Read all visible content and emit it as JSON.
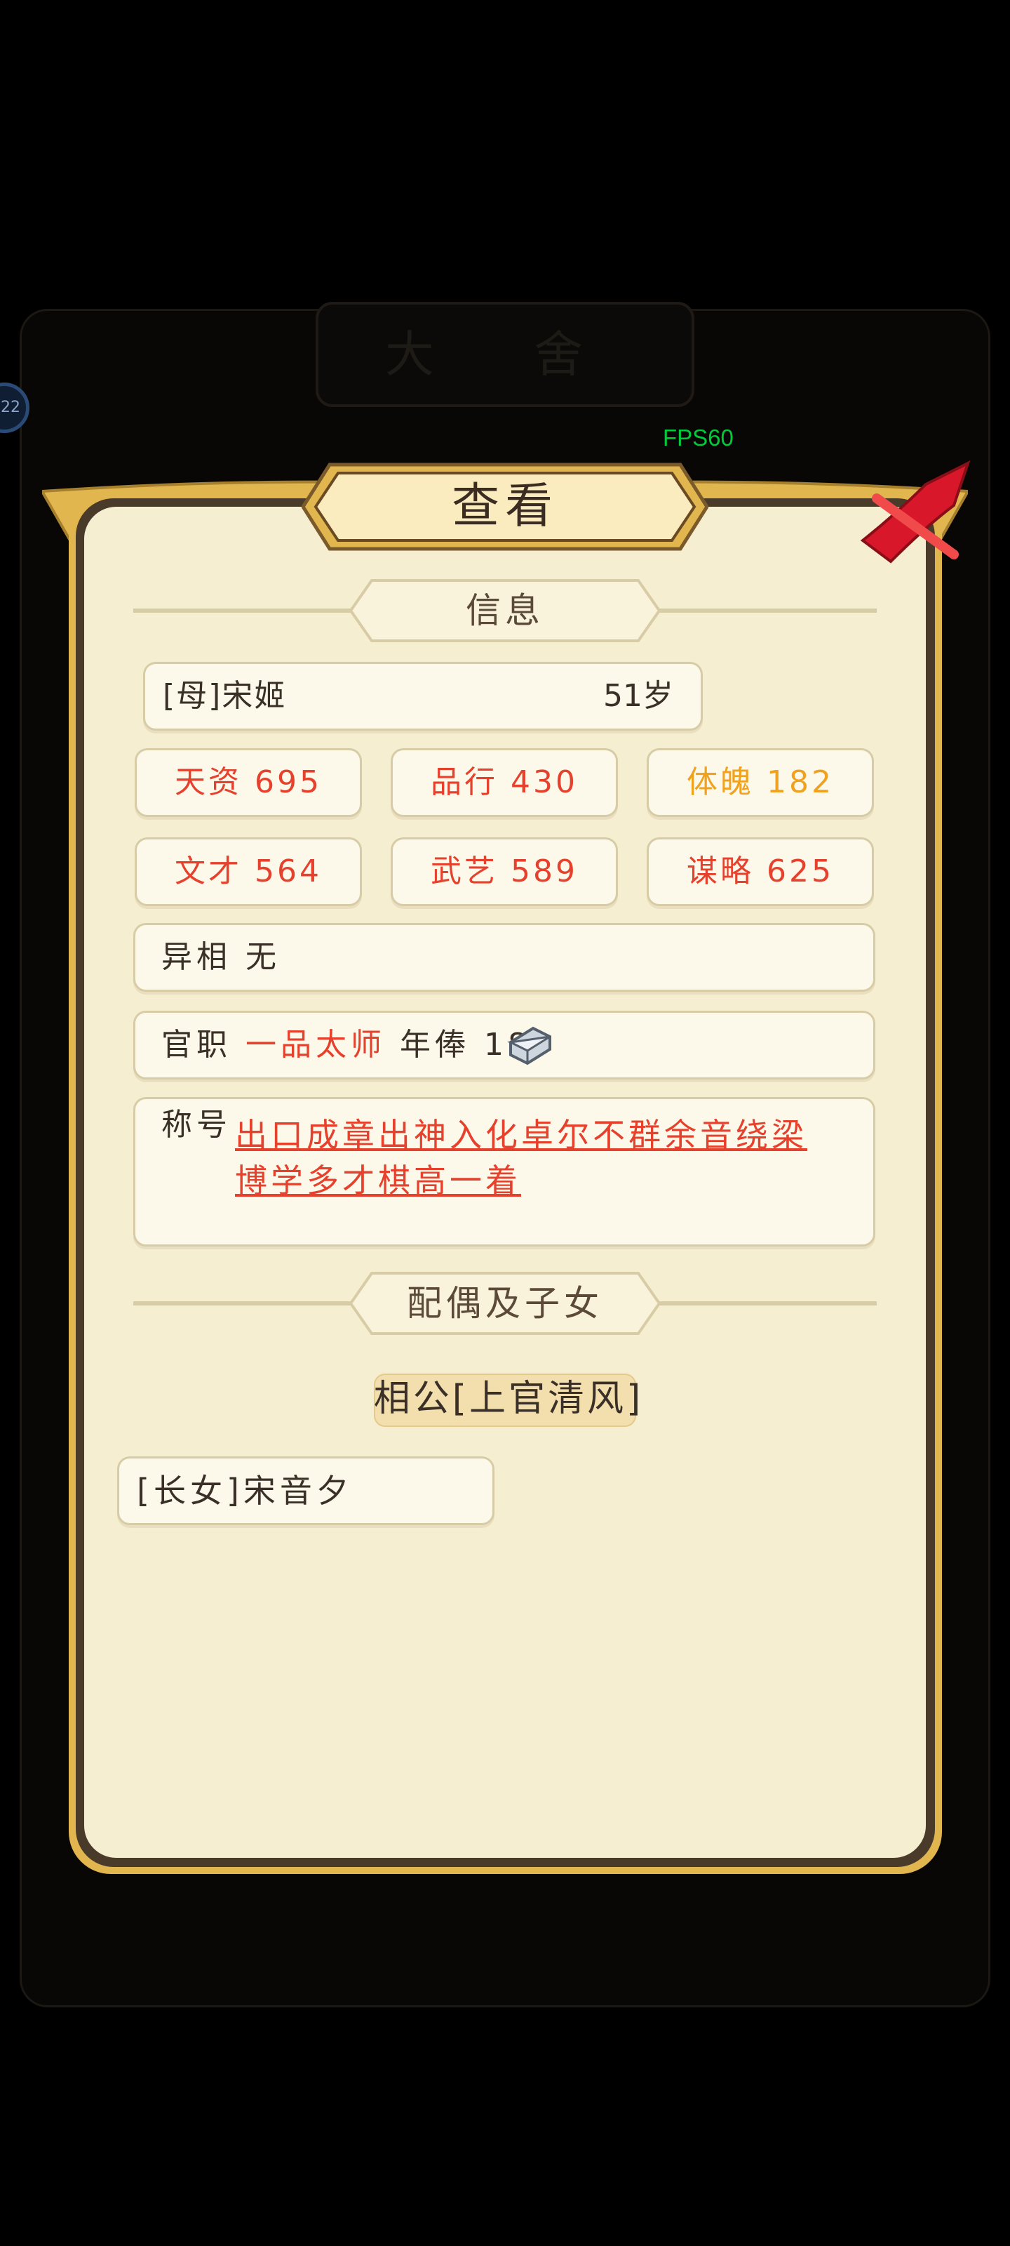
{
  "background": {
    "title": "大 舍",
    "badge_text": "22"
  },
  "fps": "FPS60",
  "dialog": {
    "title": "查看",
    "info_section": "信息",
    "person": {
      "name": "[母]宋姬",
      "age": "51岁"
    },
    "stats": [
      {
        "label": "天资",
        "value": "695"
      },
      {
        "label": "品行",
        "value": "430"
      },
      {
        "label": "体魄",
        "value": "182"
      },
      {
        "label": "文才",
        "value": "564"
      },
      {
        "label": "武艺",
        "value": "589"
      },
      {
        "label": "谋略",
        "value": "625"
      }
    ],
    "trait": {
      "label": "异相",
      "value": "无"
    },
    "office": {
      "label": "官职",
      "value": "一品太师",
      "salary_label": "年俸",
      "salary_value": "18"
    },
    "honor": {
      "label": "称号",
      "line1": "出口成章出神入化卓尔不群余音绕梁",
      "line2": "博学多才棋高一着"
    },
    "family_section": "配偶及子女",
    "spouse": "相公[上官清风]",
    "children": [
      "[长女]宋音夕"
    ]
  },
  "colors": {
    "highlight_red": "#e5412d",
    "highlight_orange": "#f0a21e",
    "parchment": "#f6eed1",
    "gold": "#e2b64e"
  }
}
